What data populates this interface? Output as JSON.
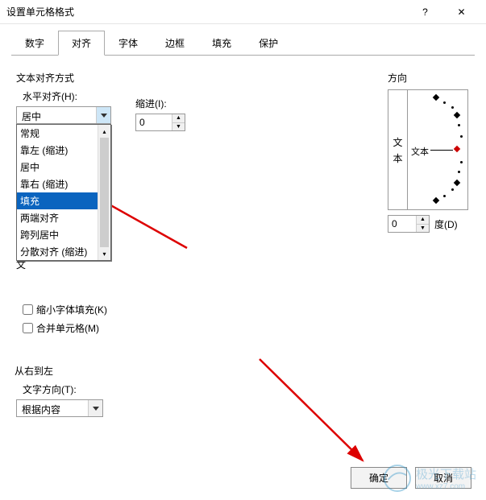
{
  "window": {
    "title": "设置单元格格式",
    "help_icon": "?",
    "close_icon": "✕"
  },
  "tabs": [
    {
      "label": "数字"
    },
    {
      "label": "对齐"
    },
    {
      "label": "字体"
    },
    {
      "label": "边框"
    },
    {
      "label": "填充"
    },
    {
      "label": "保护"
    }
  ],
  "active_tab": 1,
  "text_align": {
    "section": "文本对齐方式",
    "horizontal_label": "水平对齐(H):",
    "horizontal_value": "居中",
    "horizontal_options": [
      "常规",
      "靠左 (缩进)",
      "居中",
      "靠右 (缩进)",
      "填充",
      "两端对齐",
      "跨列居中",
      "分散对齐 (缩进)"
    ],
    "selected_option_index": 4,
    "indent_label": "缩进(I):",
    "indent_value": "0",
    "vertical_label_cut": "文"
  },
  "text_control": {
    "shrink_to_fit": "缩小字体填充(K)",
    "merge_cells": "合并单元格(M)"
  },
  "rtl": {
    "section": "从右到左",
    "dir_label": "文字方向(T):",
    "dir_value": "根据内容"
  },
  "direction": {
    "section": "方向",
    "vert_char1": "文",
    "vert_char2": "本",
    "horiz_text": "文本",
    "angle_value": "0",
    "degree_label": "度(D)"
  },
  "buttons": {
    "ok": "确定",
    "cancel": "取消"
  },
  "watermark": {
    "name": "极光下载站",
    "url": "www.xz7.com"
  }
}
